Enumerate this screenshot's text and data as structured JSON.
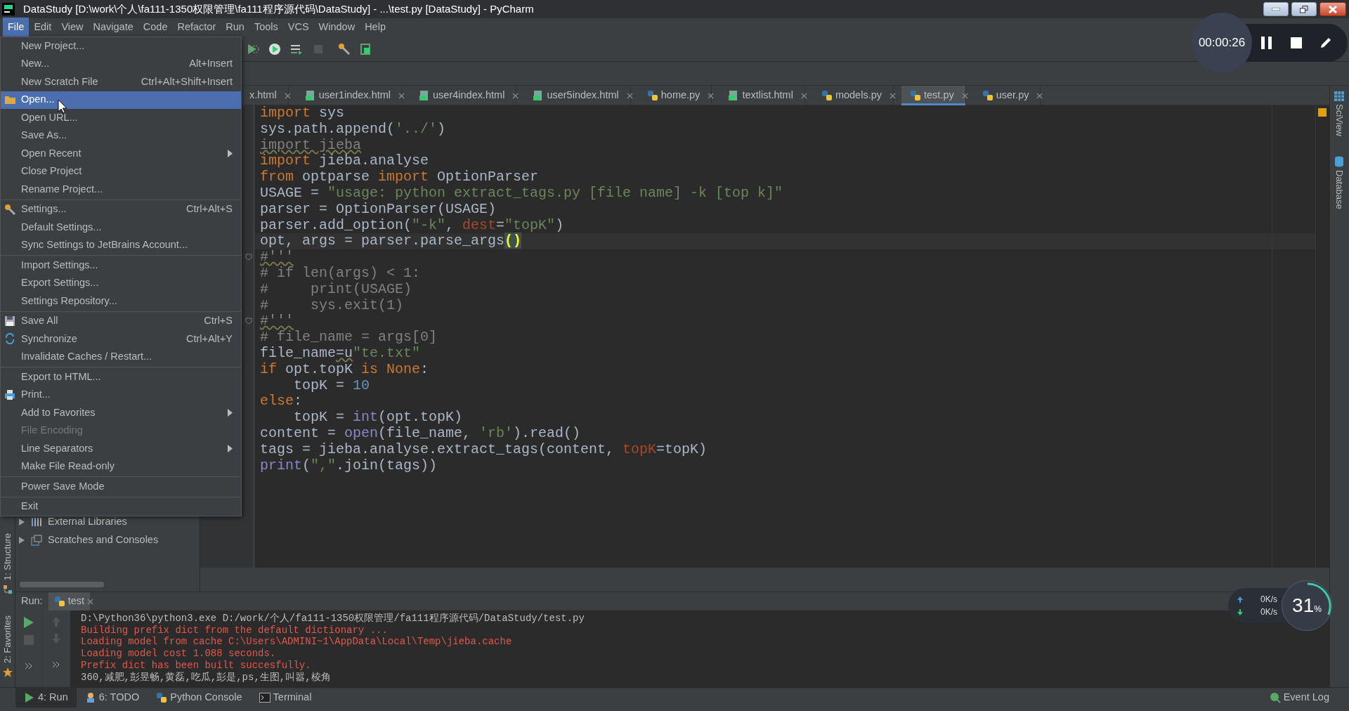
{
  "window": {
    "title": "DataStudy [D:\\work\\个人\\fa111-1350权限管理\\fa111程序源代码\\DataStudy] - ...\\test.py [DataStudy] - PyCharm"
  },
  "menu_bar": [
    {
      "label": "File",
      "selected": true
    },
    {
      "label": "Edit",
      "selected": false
    },
    {
      "label": "View",
      "selected": false
    },
    {
      "label": "Navigate",
      "selected": false
    },
    {
      "label": "Code",
      "selected": false
    },
    {
      "label": "Refactor",
      "selected": false
    },
    {
      "label": "Run",
      "selected": false
    },
    {
      "label": "Tools",
      "selected": false
    },
    {
      "label": "VCS",
      "selected": false
    },
    {
      "label": "Window",
      "selected": false
    },
    {
      "label": "Help",
      "selected": false
    }
  ],
  "file_menu": {
    "groups": [
      [
        {
          "label": "New Project...",
          "selected": false,
          "disabled": false,
          "submenu": false
        },
        {
          "label": "New...",
          "shortcut": "Alt+Insert",
          "selected": false,
          "disabled": false,
          "submenu": false
        },
        {
          "label": "New Scratch File",
          "shortcut": "Ctrl+Alt+Shift+Insert",
          "selected": false,
          "disabled": false,
          "submenu": false
        },
        {
          "label": "Open...",
          "selected": true,
          "disabled": false,
          "submenu": false
        },
        {
          "label": "Open URL...",
          "selected": false,
          "disabled": false,
          "submenu": false
        },
        {
          "label": "Save As...",
          "selected": false,
          "disabled": false,
          "submenu": false
        },
        {
          "label": "Open Recent",
          "selected": false,
          "disabled": false,
          "submenu": true
        },
        {
          "label": "Close Project",
          "selected": false,
          "disabled": false,
          "submenu": false
        },
        {
          "label": "Rename Project...",
          "selected": false,
          "disabled": false,
          "submenu": false
        }
      ],
      [
        {
          "label": "Settings...",
          "shortcut": "Ctrl+Alt+S",
          "selected": false,
          "disabled": false,
          "submenu": false
        },
        {
          "label": "Default Settings...",
          "selected": false,
          "disabled": false,
          "submenu": false
        },
        {
          "label": "Sync Settings to JetBrains Account...",
          "selected": false,
          "disabled": false,
          "submenu": false
        }
      ],
      [
        {
          "label": "Import Settings...",
          "selected": false,
          "disabled": false,
          "submenu": false
        },
        {
          "label": "Export Settings...",
          "selected": false,
          "disabled": false,
          "submenu": false
        },
        {
          "label": "Settings Repository...",
          "selected": false,
          "disabled": false,
          "submenu": false
        }
      ],
      [
        {
          "label": "Save All",
          "shortcut": "Ctrl+S",
          "selected": false,
          "disabled": false,
          "submenu": false
        },
        {
          "label": "Synchronize",
          "shortcut": "Ctrl+Alt+Y",
          "selected": false,
          "disabled": false,
          "submenu": false
        },
        {
          "label": "Invalidate Caches / Restart...",
          "selected": false,
          "disabled": false,
          "submenu": false
        }
      ],
      [
        {
          "label": "Export to HTML...",
          "selected": false,
          "disabled": false,
          "submenu": false
        },
        {
          "label": "Print...",
          "selected": false,
          "disabled": false,
          "submenu": false
        },
        {
          "label": "Add to Favorites",
          "selected": false,
          "disabled": false,
          "submenu": true
        },
        {
          "label": "File Encoding",
          "selected": false,
          "disabled": true,
          "submenu": false
        },
        {
          "label": "Line Separators",
          "selected": false,
          "disabled": false,
          "submenu": true
        },
        {
          "label": "Make File Read-only",
          "selected": false,
          "disabled": false,
          "submenu": false
        }
      ],
      [
        {
          "label": "Power Save Mode",
          "selected": false,
          "disabled": false,
          "submenu": false
        }
      ],
      [
        {
          "label": "Exit",
          "selected": false,
          "disabled": false,
          "submenu": false
        }
      ]
    ]
  },
  "tabs": [
    {
      "label": "x.html",
      "selected": false
    },
    {
      "label": "user1index.html",
      "kind": "html",
      "selected": false
    },
    {
      "label": "user4index.html",
      "kind": "html",
      "selected": false
    },
    {
      "label": "user5index.html",
      "kind": "html",
      "selected": false
    },
    {
      "label": "home.py",
      "kind": "py",
      "selected": false
    },
    {
      "label": "textlist.html",
      "kind": "html",
      "selected": false
    },
    {
      "label": "models.py",
      "kind": "py",
      "selected": false
    },
    {
      "label": "test.py",
      "kind": "py",
      "selected": true
    },
    {
      "label": "user.py",
      "kind": "py",
      "selected": false
    }
  ],
  "editor": {
    "lines": [
      {
        "current": false,
        "tokens": [
          {
            "kind": "keyword",
            "text": "import"
          },
          {
            "kind": "plain",
            "text": " sys"
          }
        ]
      },
      {
        "current": false,
        "tokens": [
          {
            "kind": "plain",
            "text": "sys.path.append("
          },
          {
            "kind": "string",
            "text": "'../'"
          },
          {
            "kind": "plain",
            "text": ")"
          }
        ]
      },
      {
        "current": false,
        "tokens": [
          {
            "kind": "unused",
            "text": "import jieba"
          }
        ]
      },
      {
        "current": false,
        "tokens": [
          {
            "kind": "keyword",
            "text": "import"
          },
          {
            "kind": "plain",
            "text": " jieba.analyse"
          }
        ]
      },
      {
        "current": false,
        "tokens": [
          {
            "kind": "keyword",
            "text": "from"
          },
          {
            "kind": "plain",
            "text": " optparse "
          },
          {
            "kind": "keyword",
            "text": "import"
          },
          {
            "kind": "plain",
            "text": " OptionParser"
          }
        ]
      },
      {
        "current": false,
        "tokens": [
          {
            "kind": "plain",
            "text": "USAGE = "
          },
          {
            "kind": "string",
            "text": "\"usage: python extract_tags.py [file name] -k [top k]\""
          }
        ]
      },
      {
        "current": false,
        "tokens": [
          {
            "kind": "plain",
            "text": "parser = OptionParser(USAGE)"
          }
        ]
      },
      {
        "current": false,
        "tokens": [
          {
            "kind": "plain",
            "text": "parser.add_option("
          },
          {
            "kind": "string",
            "text": "\"-k\""
          },
          {
            "kind": "plain",
            "text": ", "
          },
          {
            "kind": "param",
            "text": "dest"
          },
          {
            "kind": "plain",
            "text": "="
          },
          {
            "kind": "string",
            "text": "\"topK\""
          },
          {
            "kind": "plain",
            "text": ")"
          }
        ]
      },
      {
        "current": true,
        "tokens": [
          {
            "kind": "plain",
            "text": "opt, args = parser.parse_args"
          },
          {
            "kind": "brace",
            "text": "()"
          }
        ]
      },
      {
        "current": false,
        "tokens": [
          {
            "kind": "comment_warn",
            "text": "#'''"
          }
        ]
      },
      {
        "current": false,
        "tokens": [
          {
            "kind": "comment",
            "text": "# if len(args) < 1:"
          }
        ]
      },
      {
        "current": false,
        "tokens": [
          {
            "kind": "comment",
            "text": "#     print(USAGE)"
          }
        ]
      },
      {
        "current": false,
        "tokens": [
          {
            "kind": "comment",
            "text": "#     sys.exit(1)"
          }
        ]
      },
      {
        "current": false,
        "tokens": [
          {
            "kind": "comment_warn",
            "text": "#'''"
          }
        ]
      },
      {
        "current": false,
        "tokens": [
          {
            "kind": "comment",
            "text": "# file_name = args[0]"
          }
        ]
      },
      {
        "current": false,
        "tokens": [
          {
            "kind": "plain",
            "text": "file_name"
          },
          {
            "kind": "warn",
            "text": "=u"
          },
          {
            "kind": "string",
            "text": "\"te.txt\""
          }
        ]
      },
      {
        "current": false,
        "tokens": [
          {
            "kind": "keyword",
            "text": "if"
          },
          {
            "kind": "plain",
            "text": " opt.topK "
          },
          {
            "kind": "keyword",
            "text": "is None"
          },
          {
            "kind": "plain",
            "text": ":"
          }
        ]
      },
      {
        "current": false,
        "tokens": [
          {
            "kind": "plain",
            "text": "    topK = "
          },
          {
            "kind": "number",
            "text": "10"
          }
        ]
      },
      {
        "current": false,
        "tokens": [
          {
            "kind": "keyword",
            "text": "else"
          },
          {
            "kind": "plain",
            "text": ":"
          }
        ]
      },
      {
        "current": false,
        "tokens": [
          {
            "kind": "plain",
            "text": "    topK = "
          },
          {
            "kind": "builtin",
            "text": "int"
          },
          {
            "kind": "plain",
            "text": "(opt.topK)"
          }
        ]
      },
      {
        "current": false,
        "tokens": [
          {
            "kind": "plain",
            "text": "content = "
          },
          {
            "kind": "builtin",
            "text": "open"
          },
          {
            "kind": "plain",
            "text": "(file_name, "
          },
          {
            "kind": "string",
            "text": "'rb'"
          },
          {
            "kind": "plain",
            "text": ").read()"
          }
        ]
      },
      {
        "current": false,
        "tokens": [
          {
            "kind": "plain",
            "text": "tags = jieba.analyse.extract_tags(content, "
          },
          {
            "kind": "param",
            "text": "topK"
          },
          {
            "kind": "plain",
            "text": "=topK)"
          }
        ]
      },
      {
        "current": false,
        "tokens": [
          {
            "kind": "builtin",
            "text": "print"
          },
          {
            "kind": "plain",
            "text": "("
          },
          {
            "kind": "string",
            "text": "\",\""
          },
          {
            "kind": "plain",
            "text": ".join(tags)"
          },
          {
            "kind": "plain",
            "text": ")"
          }
        ]
      }
    ]
  },
  "project_tree": [
    {
      "label": "External Libraries",
      "kind": "library",
      "expanded": false
    },
    {
      "label": "Scratches and Consoles",
      "kind": "scratches",
      "expanded": false
    }
  ],
  "left_tool_strip": [
    "1: Structure",
    "2: Favorites"
  ],
  "right_tool_strip": [
    {
      "label": "SciView",
      "kind": "grid"
    },
    {
      "label": "Database",
      "kind": "database"
    }
  ],
  "run_panel": {
    "label": "Run:",
    "tab": "test",
    "lines": [
      {
        "kind": "command",
        "text": "D:\\Python36\\python3.exe D:/work/个人/fa111-1350权限管理/fa111程序源代码/DataStudy/test.py"
      },
      {
        "kind": "error",
        "text": "Building prefix dict from the default dictionary ..."
      },
      {
        "kind": "error",
        "text": "Loading model from cache C:\\Users\\ADMINI~1\\AppData\\Local\\Temp\\jieba.cache"
      },
      {
        "kind": "error",
        "text": "Loading model cost 1.088 seconds."
      },
      {
        "kind": "error",
        "text": "Prefix dict has been built succesfully."
      },
      {
        "kind": "output",
        "text": "360,减肥,彭昱畅,黄磊,吃瓜,彭是,ps,生图,叫嚣,棱角"
      }
    ]
  },
  "bottom_bar": {
    "tabs": [
      {
        "label": "4: Run",
        "selected": true
      },
      {
        "label": "6: TODO",
        "selected": false
      },
      {
        "label": "Python Console",
        "selected": false
      },
      {
        "label": "Terminal",
        "selected": false
      }
    ],
    "event_log": "Event Log"
  },
  "recorder": {
    "time": "00:00:26"
  },
  "speed_meter": {
    "upload": "0K/s",
    "download": "0K/s",
    "value": "31",
    "unit": "%"
  }
}
